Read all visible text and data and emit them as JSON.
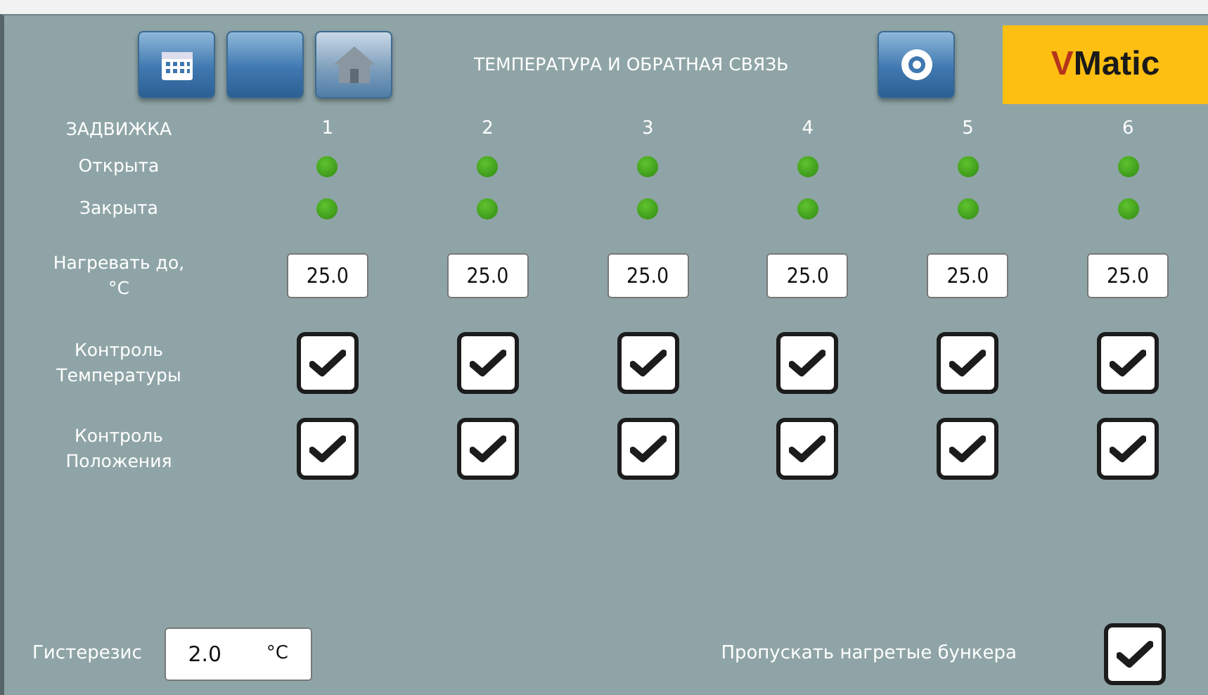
{
  "header": {
    "title": "ТЕМПЕРАТУРА И ОБРАТНАЯ СВЯЗЬ",
    "logo": {
      "prefix": "V",
      "rest": "Matic"
    }
  },
  "row_labels": {
    "valve": "ЗАДВИЖКА",
    "open": "Открыта",
    "closed": "Закрыта",
    "heat_to": "Нагревать до,°C",
    "temp_control": "Контроль Температуры",
    "position_control": "Контроль Положения"
  },
  "valves": [
    {
      "number": "1",
      "open": true,
      "closed": true,
      "heat_to": "25.0",
      "temp_control": true,
      "position_control": true
    },
    {
      "number": "2",
      "open": true,
      "closed": true,
      "heat_to": "25.0",
      "temp_control": true,
      "position_control": true
    },
    {
      "number": "3",
      "open": true,
      "closed": true,
      "heat_to": "25.0",
      "temp_control": true,
      "position_control": true
    },
    {
      "number": "4",
      "open": true,
      "closed": true,
      "heat_to": "25.0",
      "temp_control": true,
      "position_control": true
    },
    {
      "number": "5",
      "open": true,
      "closed": true,
      "heat_to": "25.0",
      "temp_control": true,
      "position_control": true
    },
    {
      "number": "6",
      "open": true,
      "closed": true,
      "heat_to": "25.0",
      "temp_control": true,
      "position_control": true
    }
  ],
  "hysteresis": {
    "label": "Гистерезис",
    "value": "2.0",
    "unit": "°C"
  },
  "skip_heated": {
    "label": "Пропускать нагретые бункера",
    "checked": true
  }
}
